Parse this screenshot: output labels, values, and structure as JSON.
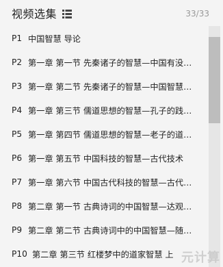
{
  "header": {
    "title": "视频选集",
    "count": "33/33",
    "list_icon": "list-icon"
  },
  "episodes": [
    {
      "p": "P1",
      "title": "中国智慧 导论"
    },
    {
      "p": "P2",
      "title": "第一章 第一节 先秦诸子的智慧—中国有没有哲学"
    },
    {
      "p": "P3",
      "title": "第一章 第二节 先秦诸子的智慧—中国智慧的特质"
    },
    {
      "p": "P4",
      "title": "第一章 第三节 儒道思想的智慧—孔子的践仁之道"
    },
    {
      "p": "P5",
      "title": "第一章 第四节 儒道思想的智慧—老子的道法自然"
    },
    {
      "p": "P6",
      "title": "第一章 第五节 中国科技的智慧—古代技术"
    },
    {
      "p": "P7",
      "title": "第一章 第六节 中国古代科技的智慧—古代科学"
    },
    {
      "p": "P8",
      "title": "第二章 第一节 古典诗词的中国智慧—达观的人生"
    },
    {
      "p": "P9",
      "title": "第二章 第二节 古典诗词中的中国智慧—随性的审美"
    },
    {
      "p": "P10",
      "title": "第二章 第三节 红楼梦中的道家智慧 上"
    }
  ],
  "watermark": "元计算",
  "colors": {
    "background": "#f4f4f4",
    "text": "#222222",
    "count": "#999999",
    "scroll_track": "#e6e6e6",
    "scroll_thumb": "#bdbdbd"
  }
}
